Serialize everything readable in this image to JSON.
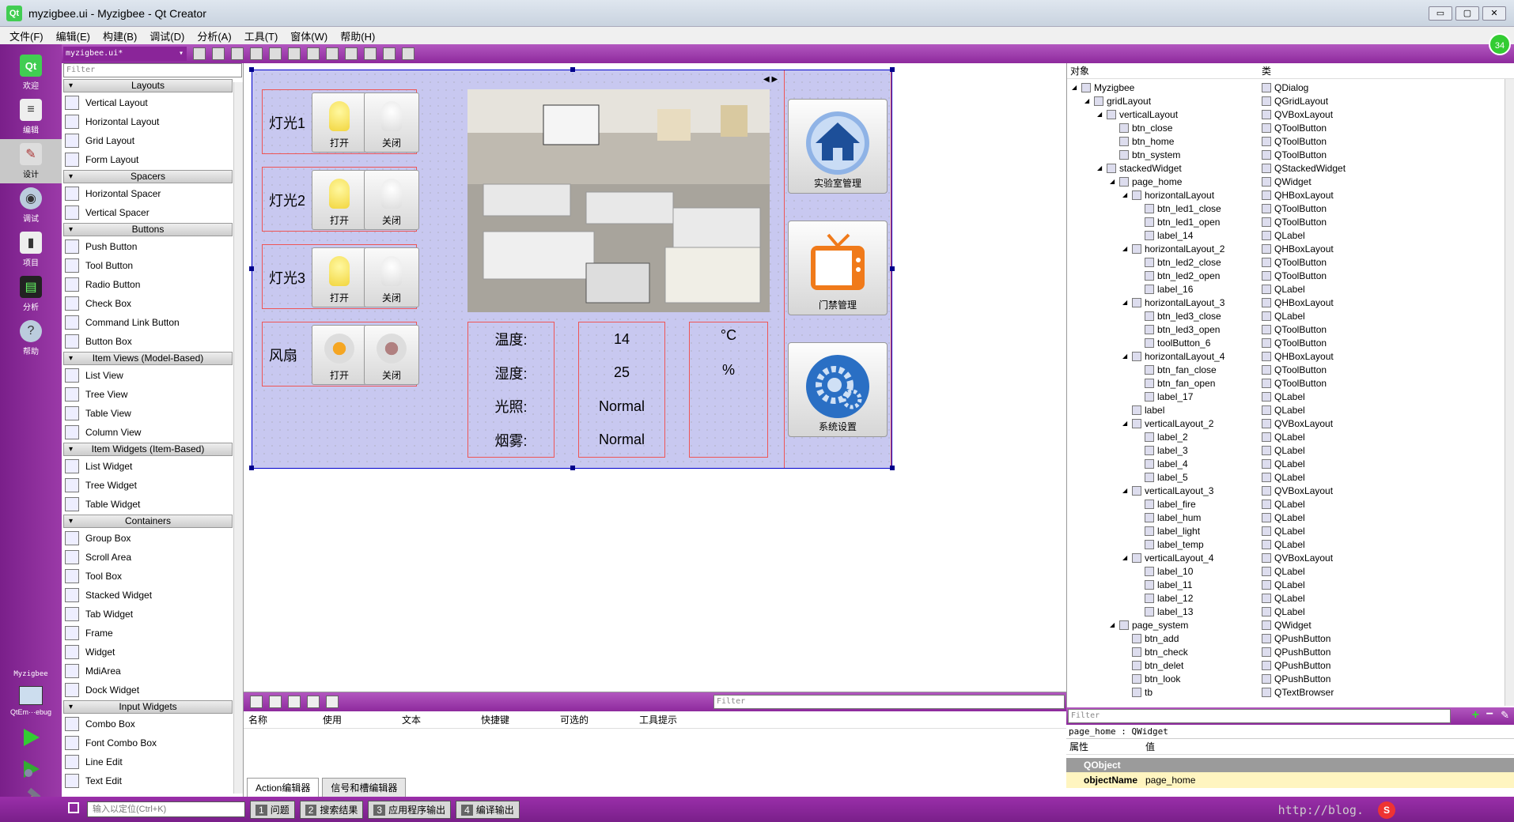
{
  "window": {
    "title": "myzigbee.ui - Myzigbee - Qt Creator",
    "logo": "Qt",
    "buttons": [
      "▭",
      "▢",
      "✕"
    ]
  },
  "menu": [
    "文件(F)",
    "编辑(E)",
    "构建(B)",
    "调试(D)",
    "分析(A)",
    "工具(T)",
    "窗体(W)",
    "帮助(H)"
  ],
  "modes": [
    {
      "label": "欢迎",
      "icon": "qt-welcome-icon"
    },
    {
      "label": "编辑",
      "icon": "edit-icon"
    },
    {
      "label": "设计",
      "icon": "design-icon",
      "active": true
    },
    {
      "label": "调试",
      "icon": "debug-icon"
    },
    {
      "label": "项目",
      "icon": "project-icon"
    },
    {
      "label": "分析",
      "icon": "analyze-icon"
    },
    {
      "label": "帮助",
      "icon": "help-icon"
    }
  ],
  "project_label": "Myzigbee",
  "kit_label": "QtEm···ebug",
  "file_combo": "myzigbee.ui*",
  "badge": "34",
  "widgetbox": {
    "filter_placeholder": "Filter",
    "sections": [
      {
        "title": "Layouts",
        "items": [
          "Vertical Layout",
          "Horizontal Layout",
          "Grid Layout",
          "Form Layout"
        ]
      },
      {
        "title": "Spacers",
        "items": [
          "Horizontal Spacer",
          "Vertical Spacer"
        ]
      },
      {
        "title": "Buttons",
        "items": [
          "Push Button",
          "Tool Button",
          "Radio Button",
          "Check Box",
          "Command Link Button",
          "Button Box"
        ]
      },
      {
        "title": "Item Views (Model-Based)",
        "items": [
          "List View",
          "Tree View",
          "Table View",
          "Column View"
        ]
      },
      {
        "title": "Item Widgets (Item-Based)",
        "items": [
          "List Widget",
          "Tree Widget",
          "Table Widget"
        ]
      },
      {
        "title": "Containers",
        "items": [
          "Group Box",
          "Scroll Area",
          "Tool Box",
          "Stacked Widget",
          "Tab Widget",
          "Frame",
          "Widget",
          "MdiArea",
          "Dock Widget"
        ]
      },
      {
        "title": "Input Widgets",
        "items": [
          "Combo Box",
          "Font Combo Box",
          "Line Edit",
          "Text Edit"
        ]
      }
    ]
  },
  "form": {
    "lights": [
      {
        "label": "灯光1",
        "open": "打开",
        "close": "关闭"
      },
      {
        "label": "灯光2",
        "open": "打开",
        "close": "关闭"
      },
      {
        "label": "灯光3",
        "open": "打开",
        "close": "关闭"
      },
      {
        "label": "风扇",
        "open": "打开",
        "close": "关闭"
      }
    ],
    "sensor_names": [
      "温度:",
      "湿度:",
      "光照:",
      "烟雾:"
    ],
    "sensor_values": [
      "14",
      "25",
      "Normal",
      "Normal"
    ],
    "sensor_units": [
      "°C",
      "%"
    ],
    "side_buttons": [
      "实验室管理",
      "门禁管理",
      "系统设置"
    ]
  },
  "action_editor": {
    "filter_placeholder": "Filter",
    "columns": [
      "名称",
      "使用",
      "文本",
      "快捷键",
      "可选的",
      "工具提示"
    ],
    "tabs": [
      "Action编辑器",
      "信号和槽编辑器"
    ]
  },
  "object_inspector": {
    "headers": [
      "对象",
      "类"
    ],
    "rows": [
      {
        "indent": 0,
        "name": "Myzigbee",
        "cls": "QDialog",
        "exp": "◢"
      },
      {
        "indent": 1,
        "name": "gridLayout",
        "cls": "QGridLayout",
        "exp": "◢"
      },
      {
        "indent": 2,
        "name": "verticalLayout",
        "cls": "QVBoxLayout",
        "exp": "◢"
      },
      {
        "indent": 3,
        "name": "btn_close",
        "cls": "QToolButton",
        "exp": ""
      },
      {
        "indent": 3,
        "name": "btn_home",
        "cls": "QToolButton",
        "exp": ""
      },
      {
        "indent": 3,
        "name": "btn_system",
        "cls": "QToolButton",
        "exp": ""
      },
      {
        "indent": 2,
        "name": "stackedWidget",
        "cls": "QStackedWidget",
        "exp": "◢"
      },
      {
        "indent": 3,
        "name": "page_home",
        "cls": "QWidget",
        "exp": "◢"
      },
      {
        "indent": 4,
        "name": "horizontalLayout",
        "cls": "QHBoxLayout",
        "exp": "◢"
      },
      {
        "indent": 5,
        "name": "btn_led1_close",
        "cls": "QToolButton",
        "exp": ""
      },
      {
        "indent": 5,
        "name": "btn_led1_open",
        "cls": "QToolButton",
        "exp": ""
      },
      {
        "indent": 5,
        "name": "label_14",
        "cls": "QLabel",
        "exp": ""
      },
      {
        "indent": 4,
        "name": "horizontalLayout_2",
        "cls": "QHBoxLayout",
        "exp": "◢"
      },
      {
        "indent": 5,
        "name": "btn_led2_close",
        "cls": "QToolButton",
        "exp": ""
      },
      {
        "indent": 5,
        "name": "btn_led2_open",
        "cls": "QToolButton",
        "exp": ""
      },
      {
        "indent": 5,
        "name": "label_16",
        "cls": "QLabel",
        "exp": ""
      },
      {
        "indent": 4,
        "name": "horizontalLayout_3",
        "cls": "QHBoxLayout",
        "exp": "◢"
      },
      {
        "indent": 5,
        "name": "btn_led3_close",
        "cls": "QLabel",
        "exp": ""
      },
      {
        "indent": 5,
        "name": "btn_led3_open",
        "cls": "QToolButton",
        "exp": ""
      },
      {
        "indent": 5,
        "name": "toolButton_6",
        "cls": "QToolButton",
        "exp": ""
      },
      {
        "indent": 4,
        "name": "horizontalLayout_4",
        "cls": "QHBoxLayout",
        "exp": "◢"
      },
      {
        "indent": 5,
        "name": "btn_fan_close",
        "cls": "QToolButton",
        "exp": ""
      },
      {
        "indent": 5,
        "name": "btn_fan_open",
        "cls": "QToolButton",
        "exp": ""
      },
      {
        "indent": 5,
        "name": "label_17",
        "cls": "QLabel",
        "exp": ""
      },
      {
        "indent": 4,
        "name": "label",
        "cls": "QLabel",
        "exp": ""
      },
      {
        "indent": 4,
        "name": "verticalLayout_2",
        "cls": "QVBoxLayout",
        "exp": "◢"
      },
      {
        "indent": 5,
        "name": "label_2",
        "cls": "QLabel",
        "exp": ""
      },
      {
        "indent": 5,
        "name": "label_3",
        "cls": "QLabel",
        "exp": ""
      },
      {
        "indent": 5,
        "name": "label_4",
        "cls": "QLabel",
        "exp": ""
      },
      {
        "indent": 5,
        "name": "label_5",
        "cls": "QLabel",
        "exp": ""
      },
      {
        "indent": 4,
        "name": "verticalLayout_3",
        "cls": "QVBoxLayout",
        "exp": "◢"
      },
      {
        "indent": 5,
        "name": "label_fire",
        "cls": "QLabel",
        "exp": ""
      },
      {
        "indent": 5,
        "name": "label_hum",
        "cls": "QLabel",
        "exp": ""
      },
      {
        "indent": 5,
        "name": "label_light",
        "cls": "QLabel",
        "exp": ""
      },
      {
        "indent": 5,
        "name": "label_temp",
        "cls": "QLabel",
        "exp": ""
      },
      {
        "indent": 4,
        "name": "verticalLayout_4",
        "cls": "QVBoxLayout",
        "exp": "◢"
      },
      {
        "indent": 5,
        "name": "label_10",
        "cls": "QLabel",
        "exp": ""
      },
      {
        "indent": 5,
        "name": "label_11",
        "cls": "QLabel",
        "exp": ""
      },
      {
        "indent": 5,
        "name": "label_12",
        "cls": "QLabel",
        "exp": ""
      },
      {
        "indent": 5,
        "name": "label_13",
        "cls": "QLabel",
        "exp": ""
      },
      {
        "indent": 3,
        "name": "page_system",
        "cls": "QWidget",
        "exp": "◢"
      },
      {
        "indent": 4,
        "name": "btn_add",
        "cls": "QPushButton",
        "exp": ""
      },
      {
        "indent": 4,
        "name": "btn_check",
        "cls": "QPushButton",
        "exp": ""
      },
      {
        "indent": 4,
        "name": "btn_delet",
        "cls": "QPushButton",
        "exp": ""
      },
      {
        "indent": 4,
        "name": "btn_look",
        "cls": "QPushButton",
        "exp": ""
      },
      {
        "indent": 4,
        "name": "tb",
        "cls": "QTextBrowser",
        "exp": ""
      }
    ]
  },
  "property_editor": {
    "filter_placeholder": "Filter",
    "current": "page_home : QWidget",
    "headers": [
      "属性",
      "值"
    ],
    "section": "QObject",
    "object_name_key": "objectName",
    "object_name_value": "page_home"
  },
  "statusbar": {
    "locator_placeholder": "输入以定位(Ctrl+K)",
    "tabs": [
      {
        "num": "1",
        "label": "问题"
      },
      {
        "num": "2",
        "label": "搜索结果"
      },
      {
        "num": "3",
        "label": "应用程序输出"
      },
      {
        "num": "4",
        "label": "编译输出"
      }
    ],
    "watermark": "http://blog."
  },
  "colors": {
    "accent_purple": "#8e2a9d",
    "form_bg": "#c8c8f0",
    "property_header": "#9b9b9b",
    "object_name_row": "#fff5c0"
  }
}
